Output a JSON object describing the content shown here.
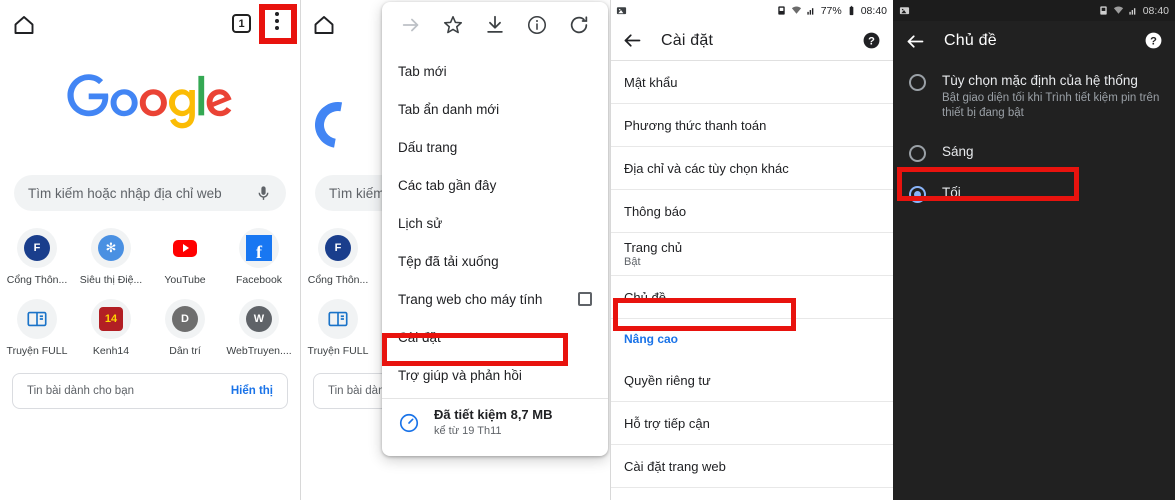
{
  "panel1": {
    "name": "chrome-home",
    "toolbar": {
      "home_icon": "home-icon",
      "tab_count": "1",
      "menu_icon": "overflow-menu-icon"
    },
    "logo_alt": "Google",
    "search": {
      "placeholder": "Tìm kiếm hoặc nhập địa chỉ web",
      "mic_icon": "microphone-icon"
    },
    "shortcuts": [
      {
        "label": "Cổng Thôn...",
        "glyph": "F",
        "bg": "#1a3e8c",
        "style": "letter"
      },
      {
        "label": "Siêu thị Điệ...",
        "glyph": "",
        "bg": "#4a90e2",
        "style": "dienmay"
      },
      {
        "label": "YouTube",
        "glyph": "",
        "bg": "#ffffff",
        "style": "youtube"
      },
      {
        "label": "Facebook",
        "glyph": "f",
        "bg": "#1877f2",
        "style": "facebook"
      },
      {
        "label": "Truyện FULL",
        "glyph": "",
        "bg": "#ffffff",
        "style": "book"
      },
      {
        "label": "Kenh14",
        "glyph": "14",
        "bg": "#b21f24",
        "style": "kenh14"
      },
      {
        "label": "Dân trí",
        "glyph": "D",
        "bg": "#6e6e6e",
        "style": "letter"
      },
      {
        "label": "WebTruyen....",
        "glyph": "W",
        "bg": "#5f6368",
        "style": "letter"
      }
    ],
    "news_card": {
      "title": "Tin bài dành cho bạn",
      "action": "Hiển thị"
    },
    "highlight": "overflow-menu-icon"
  },
  "panel2": {
    "name": "chrome-overflow-menu",
    "background_home": {
      "search_placeholder": "Tìm kiếm",
      "shortcuts": [
        {
          "label": "Cổng Thôn...",
          "glyph": "F",
          "bg": "#1a3e8c",
          "style": "letter"
        },
        {
          "label": "Truyện FULL",
          "glyph": "",
          "bg": "#ffffff",
          "style": "book"
        }
      ],
      "news_card_title": "Tin bài dành"
    },
    "quick_icons": [
      "forward-arrow-icon",
      "bookmark-star-icon",
      "download-icon",
      "page-info-icon",
      "reload-icon"
    ],
    "items": [
      {
        "label": "Tab mới"
      },
      {
        "label": "Tab ẩn danh mới"
      },
      {
        "label": "Dấu trang"
      },
      {
        "label": "Các tab gần đây"
      },
      {
        "label": "Lịch sử"
      },
      {
        "label": "Tệp đã tải xuống"
      },
      {
        "label": "Trang web cho máy tính",
        "checkbox": true
      },
      {
        "label": "Cài đặt",
        "highlighted": true
      },
      {
        "label": "Trợ giúp và phản hồi"
      }
    ],
    "data_saver": {
      "icon": "data-saver-gauge-icon",
      "primary": "Đã tiết kiệm 8,7 MB",
      "secondary": "kể từ 19 Th11"
    }
  },
  "panel3": {
    "name": "chrome-settings",
    "status_bar": {
      "image_icon": "image-icon",
      "alarm_icon": "alarm-icon",
      "wifi_icon": "wifi-icon",
      "signal_icon": "signal-icon",
      "battery_percent": "77%",
      "battery_icon": "battery-icon",
      "clock": "08:40"
    },
    "appbar": {
      "back_icon": "back-arrow-icon",
      "title": "Cài đặt",
      "help_icon": "help-icon"
    },
    "rows": [
      {
        "title": "Mật khẩu"
      },
      {
        "title": "Phương thức thanh toán"
      },
      {
        "title": "Địa chỉ và các tùy chọn khác"
      },
      {
        "title": "Thông báo"
      },
      {
        "title": "Trang chủ",
        "sub": "Bật"
      },
      {
        "title": "Chủ đề",
        "highlighted": true
      },
      {
        "title": "Nâng cao",
        "section": true
      },
      {
        "title": "Quyền riêng tư"
      },
      {
        "title": "Hỗ trợ tiếp cận"
      },
      {
        "title": "Cài đặt trang web"
      }
    ]
  },
  "panel4": {
    "name": "chrome-theme-settings-dark",
    "status_bar": {
      "image_icon": "image-icon",
      "alarm_icon": "alarm-icon",
      "wifi_icon": "wifi-icon",
      "signal_icon": "signal-icon",
      "clock": "08:40"
    },
    "appbar": {
      "back_icon": "back-arrow-icon",
      "title": "Chủ đề",
      "help_icon": "help-icon"
    },
    "options": [
      {
        "label": "Tùy chọn mặc định của hệ thống",
        "desc": "Bật giao diện tối khi Trình tiết kiệm pin trên thiết bị đang bật",
        "selected": false
      },
      {
        "label": "Sáng",
        "desc": "",
        "selected": false
      },
      {
        "label": "Tối",
        "desc": "",
        "selected": true,
        "highlighted": true
      }
    ]
  },
  "colors": {
    "highlight_red": "#e8130e",
    "accent_blue": "#1a73e8",
    "dark_bg": "#212121",
    "dark_accent": "#8ab4f8"
  }
}
